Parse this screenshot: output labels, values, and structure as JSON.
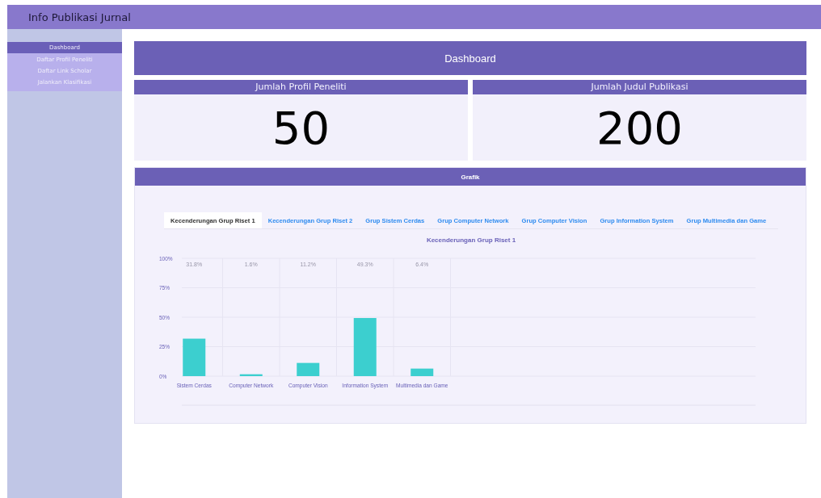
{
  "app_title": "Info Publikasi Jurnal",
  "sidebar": {
    "items": [
      {
        "label": "Dashboard",
        "selected": true
      },
      {
        "label": "Daftar Profil Peneliti",
        "selected": false
      },
      {
        "label": "Daftar Link Scholar",
        "selected": false
      },
      {
        "label": "Jalankan Klasifikasi",
        "selected": false
      }
    ]
  },
  "page_title": "Dashboard",
  "stats": [
    {
      "label": "Jumlah Profil Peneliti",
      "value": "50"
    },
    {
      "label": "Jumlah Judul Publikasi",
      "value": "200"
    }
  ],
  "chart_card": {
    "title": "Grafik",
    "tabs": [
      {
        "label": "Kecenderungan Grup Riset 1",
        "selected": true
      },
      {
        "label": "Kecenderungan Grup Riset 2",
        "selected": false
      },
      {
        "label": "Grup Sistem Cerdas",
        "selected": false
      },
      {
        "label": "Grup Computer Network",
        "selected": false
      },
      {
        "label": "Grup Computer Vision",
        "selected": false
      },
      {
        "label": "Grup Information System",
        "selected": false
      },
      {
        "label": "Grup Multimedia dan Game",
        "selected": false
      }
    ],
    "chart_data": {
      "type": "bar",
      "title": "Kecenderungan Grup Riset 1",
      "categories": [
        "Sistem Cerdas",
        "Computer Network",
        "Computer Vision",
        "Information System",
        "Multimedia dan Game"
      ],
      "series": [
        {
          "color": "#3ccfcf",
          "values": [
            31.8,
            1.6,
            11.2,
            49.3,
            6.4
          ]
        }
      ],
      "grid": true,
      "ylim": [
        0,
        100
      ],
      "yticks": [
        {
          "value": 0,
          "label": "0%"
        },
        {
          "value": 25,
          "label": "25%"
        },
        {
          "value": 50,
          "label": "50%"
        },
        {
          "value": 75,
          "label": "75%"
        },
        {
          "value": 100,
          "label": "100%"
        }
      ],
      "value_labels": [
        "31.8%",
        "1.6%",
        "11.2%",
        "49.3%",
        "6.4%"
      ]
    }
  }
}
